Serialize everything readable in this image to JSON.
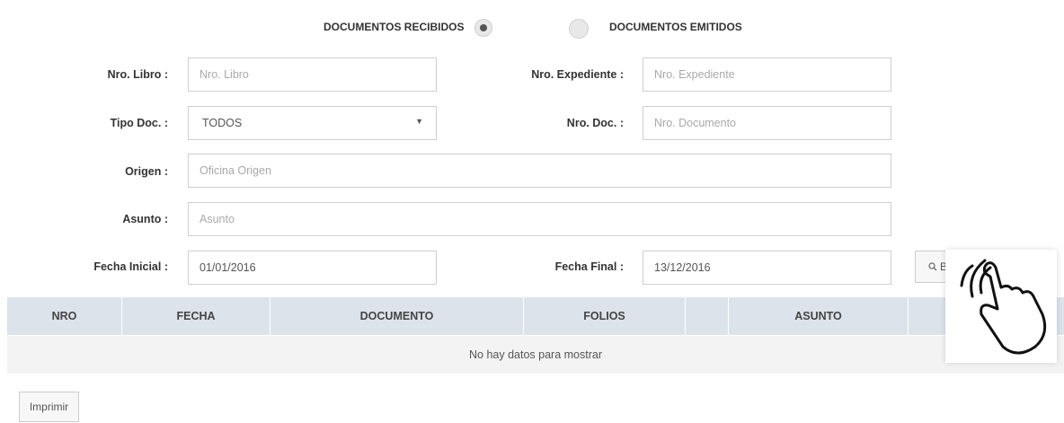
{
  "radios": {
    "recibidos_label": "DOCUMENTOS RECIBIDOS",
    "emitidos_label": "DOCUMENTOS EMITIDOS",
    "selected": "recibidos"
  },
  "form": {
    "nro_libro": {
      "label": "Nro. Libro :",
      "placeholder": "Nro. Libro",
      "value": ""
    },
    "nro_expediente": {
      "label": "Nro. Expediente :",
      "placeholder": "Nro. Expediente",
      "value": ""
    },
    "tipo_doc": {
      "label": "Tipo Doc. :",
      "value": "TODOS"
    },
    "nro_doc": {
      "label": "Nro. Doc. :",
      "placeholder": "Nro. Documento",
      "value": ""
    },
    "origen": {
      "label": "Origen :",
      "placeholder": "Oficina Origen",
      "value": ""
    },
    "asunto": {
      "label": "Asunto :",
      "placeholder": "Asunto",
      "value": ""
    },
    "fecha_inicial": {
      "label": "Fecha Inicial :",
      "value": "01/01/2016"
    },
    "fecha_final": {
      "label": "Fecha Final :",
      "value": "13/12/2016"
    },
    "buscar_label": "Bu"
  },
  "table": {
    "columns": [
      "NRO",
      "FECHA",
      "DOCUMENTO",
      "FOLIOS",
      "",
      "ASUNTO",
      ""
    ],
    "empty_message": "No hay datos para mostrar"
  },
  "print_label": "Imprimir",
  "icons": {
    "search": "search-icon",
    "caret": "caret-down-icon",
    "hand": "hand-tap-icon"
  }
}
